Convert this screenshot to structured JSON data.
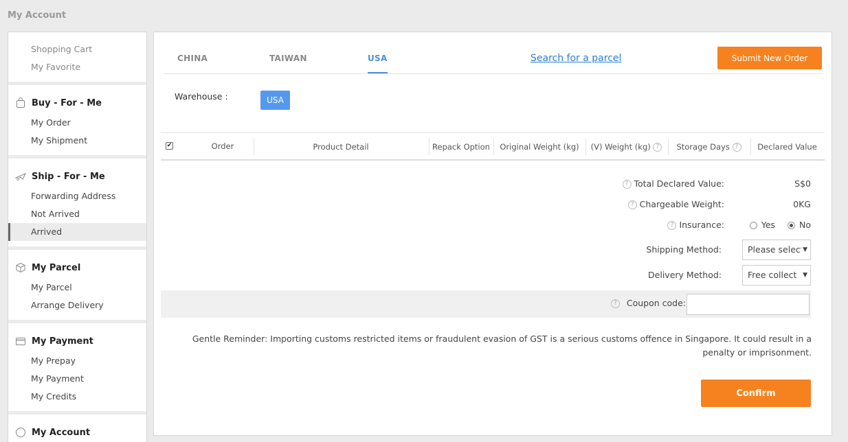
{
  "page": {
    "title": "My Account"
  },
  "sidebar": {
    "top_items": [
      "Shopping Cart",
      "My Favorite"
    ],
    "sections": [
      {
        "title": "Buy - For - Me",
        "icon": "bag-icon",
        "items": [
          "My Order",
          "My Shipment"
        ]
      },
      {
        "title": "Ship - For - Me",
        "icon": "plane-icon",
        "items": [
          "Forwarding Address",
          "Not Arrived",
          "Arrived"
        ]
      },
      {
        "title": "My Parcel",
        "icon": "box-icon",
        "items": [
          "My Parcel",
          "Arrange Delivery"
        ]
      },
      {
        "title": "My Payment",
        "icon": "card-icon",
        "items": [
          "My Prepay",
          "My Payment",
          "My Credits"
        ]
      },
      {
        "title": "My Account",
        "icon": "user-icon",
        "items": []
      }
    ],
    "active_item": "Arrived"
  },
  "tabs": [
    {
      "label": "CHINA",
      "active": false
    },
    {
      "label": "TAIWAN",
      "active": false
    },
    {
      "label": "USA",
      "active": true
    }
  ],
  "search_link": "Search for a parcel",
  "submit_button": "Submit New Order",
  "warehouse": {
    "label": "Warehouse :",
    "value": "USA"
  },
  "table": {
    "headers": [
      "Order",
      "Product Detail",
      "Repack Option",
      "Original Weight (kg)",
      "(V) Weight (kg)",
      "Storage Days",
      "Declared Value"
    ],
    "select_all_checked": true
  },
  "summary": {
    "total_declared_label": "Total Declared Value:",
    "total_declared_value": "S$0",
    "chargeable_weight_label": "Chargeable Weight:",
    "chargeable_weight_value": "0KG",
    "insurance_label": "Insurance:",
    "insurance_yes": "Yes",
    "insurance_no": "No",
    "insurance_selected": "No",
    "shipping_method_label": "Shipping Method:",
    "shipping_method_value": "Please select",
    "delivery_method_label": "Delivery Method:",
    "delivery_method_value": "Free collect",
    "coupon_label": "Coupon code:",
    "coupon_value": ""
  },
  "reminder": "Gentle Reminder: Importing customs restricted items or fraudulent evasion of GST is a serious customs offence in Singapore. It could result in a penalty or imprisonment.",
  "confirm_button": "Confirm",
  "colors": {
    "accent_orange": "#f5821f",
    "tab_active_blue": "#4a90d9",
    "link_blue": "#2a7fd4"
  }
}
